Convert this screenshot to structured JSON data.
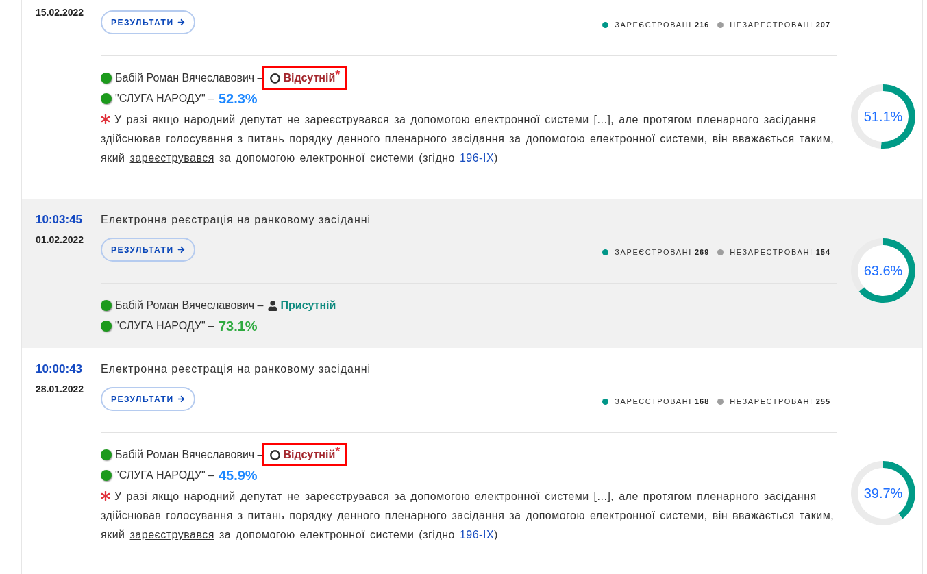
{
  "entries": [
    {
      "date": "15.02.2022",
      "results_button": "РЕЗУЛЬТАТИ",
      "stats": [
        {
          "label": "ЗАРЕЄСТРОВАНІ",
          "count": "216",
          "color": "#009688"
        },
        {
          "label": "НЕЗАРЕСТРОВАНІ",
          "count": "207",
          "color": "#9e9e9e"
        }
      ],
      "deputy": {
        "name": "Бабій Роман Вячеславович –",
        "status": {
          "kind": "absent",
          "label": "Відсутній",
          "mark": "*",
          "highlighted": true
        }
      },
      "party": {
        "name": "\"СЛУГА НАРОДУ\" –",
        "percent": "52.3%",
        "color": "#1e88ff"
      },
      "registration": {
        "chart_data": {
          "type": "donut",
          "values": [
            51.1,
            48.9
          ]
        },
        "reading": "51.1%"
      },
      "note": {
        "text_before": "У разі якщо народний депутат не зареєструвався за допомогою електронної системи [...], але протягом пленарного засідання здійснював голосування з питань порядку денного пленарного засідання за допомогою електронної системи, він вважається таким, який",
        "term_link": "зареєструвався",
        "text_middle": "за допомогою електронної системи (згідно",
        "law_link": "196-IX",
        "text_after": ")"
      }
    },
    {
      "time": "10:03:45",
      "date": "01.02.2022",
      "title": "Електронна реєстрація на ранковому засіданні",
      "results_button": "РЕЗУЛЬТАТИ",
      "stats": [
        {
          "label": "ЗАРЕЄСТРОВАНІ",
          "count": "269",
          "color": "#009688"
        },
        {
          "label": "НЕЗАРЕСТРОВАНІ",
          "count": "154",
          "color": "#9e9e9e"
        }
      ],
      "deputy": {
        "name": "Бабій Роман Вячеславович –",
        "status": {
          "kind": "present",
          "label": "Присутній",
          "highlighted": false
        }
      },
      "party": {
        "name": "\"СЛУГА НАРОДУ\" –",
        "percent": "73.1%",
        "color": "#2eaa3f"
      },
      "registration": {
        "chart_data": {
          "type": "donut",
          "values": [
            63.6,
            36.4
          ]
        },
        "reading": "63.6%"
      }
    },
    {
      "time": "10:00:43",
      "date": "28.01.2022",
      "title": "Електронна реєстрація на ранковому засіданні",
      "results_button": "РЕЗУЛЬТАТИ",
      "stats": [
        {
          "label": "ЗАРЕЄСТРОВАНІ",
          "count": "168",
          "color": "#009688"
        },
        {
          "label": "НЕЗАРЕСТРОВАНІ",
          "count": "255",
          "color": "#9e9e9e"
        }
      ],
      "deputy": {
        "name": "Бабій Роман Вячеславович –",
        "status": {
          "kind": "absent",
          "label": "Відсутній",
          "mark": "*",
          "highlighted": true
        }
      },
      "party": {
        "name": "\"СЛУГА НАРОДУ\" –",
        "percent": "45.9%",
        "color": "#1e88ff"
      },
      "registration": {
        "chart_data": {
          "type": "donut",
          "values": [
            39.7,
            60.3
          ]
        },
        "reading": "39.7%"
      },
      "note": {
        "text_before": "У разі якщо народний депутат не зареєструвався за допомогою електронної системи [...], але протягом пленарного засідання здійснював голосування з питань порядку денного пленарного засідання за допомогою електронної системи, він вважається таким, який",
        "term_link": "зареєструвався",
        "text_middle": "за допомогою електронної системи (згідно",
        "law_link": "196-IX",
        "text_after": ")"
      }
    }
  ]
}
